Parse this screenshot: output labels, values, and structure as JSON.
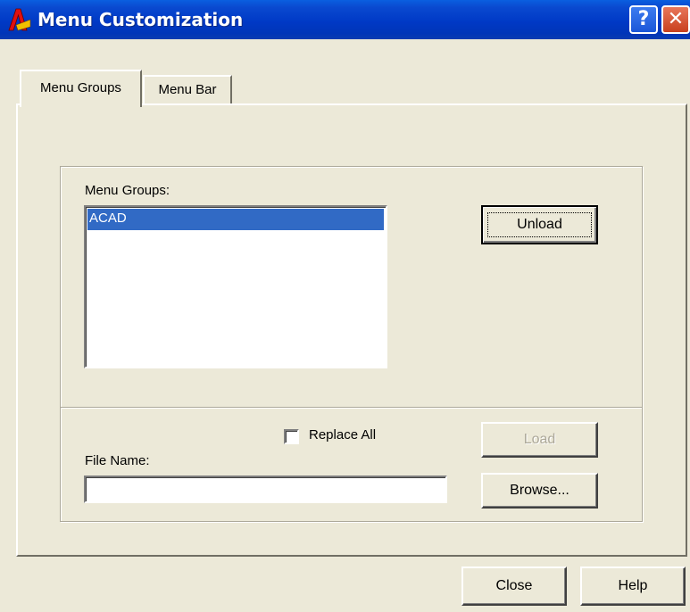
{
  "window": {
    "title": "Menu Customization",
    "help_glyph": "?",
    "close_glyph": "✕",
    "app_icon": "autocad-icon"
  },
  "tabs": [
    {
      "label": "Menu Groups",
      "selected": true
    },
    {
      "label": "Menu Bar",
      "selected": false
    }
  ],
  "menu_groups": {
    "label": "Menu Groups:",
    "items": [
      "ACAD"
    ],
    "selected_item": "ACAD",
    "unload_label": "Unload"
  },
  "load_section": {
    "replace_all_label": "Replace All",
    "replace_all_checked": false,
    "file_name_label": "File Name:",
    "file_name_value": "",
    "load_label": "Load",
    "load_enabled": false,
    "browse_label": "Browse..."
  },
  "footer": {
    "close_label": "Close",
    "help_label": "Help"
  },
  "colors": {
    "titlebar": "#0039c6",
    "dialog_bg": "#ece9d8",
    "selection": "#316ac5"
  }
}
